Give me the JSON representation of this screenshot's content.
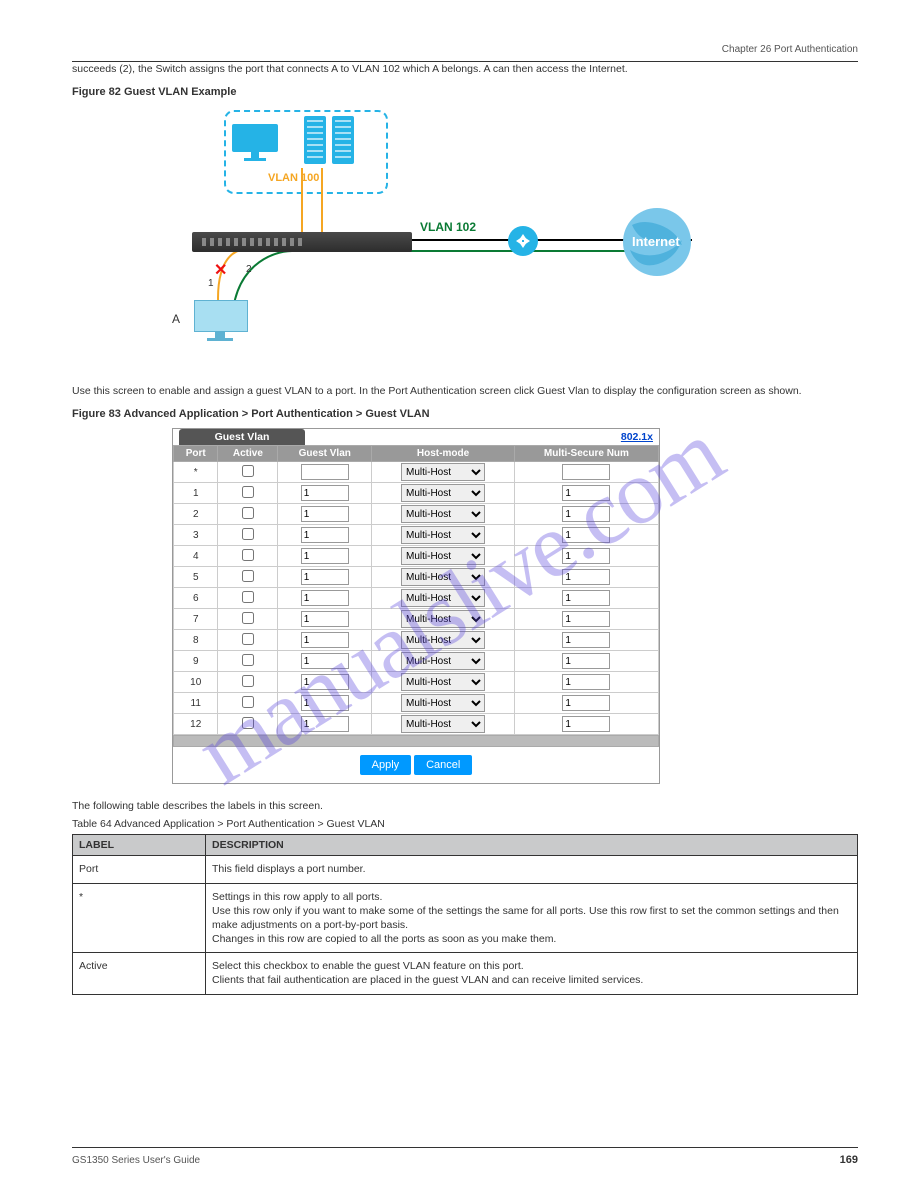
{
  "header": {
    "left": "",
    "right": "Chapter 26 Port Authentication"
  },
  "para_intro": "succeeds (2), the Switch assigns the port that connects A to VLAN 102 which A belongs. A can then access the Internet.",
  "figure82_title": "Figure 82  Guest VLAN Example",
  "diagram": {
    "vlan100": "VLAN 100",
    "vlan102": "VLAN 102",
    "internet": "Internet",
    "markerA": "A",
    "marker1": "1",
    "marker2": "2"
  },
  "body2": "Use this screen to enable and assign a guest VLAN to a port. In the Port Authentication screen click Guest Vlan to display the configuration screen as shown.",
  "figure83_title": "Figure 83  Advanced Application > Port Authentication > Guest VLAN",
  "screenshot": {
    "tab": "Guest Vlan",
    "link": "802.1x",
    "columns": [
      "Port",
      "Active",
      "Guest Vlan",
      "Host-mode",
      "Multi-Secure Num"
    ],
    "star": "*",
    "rows": [
      {
        "port": "1",
        "gvlan": "1",
        "mode": "Multi-Host",
        "msn": "1"
      },
      {
        "port": "2",
        "gvlan": "1",
        "mode": "Multi-Host",
        "msn": "1"
      },
      {
        "port": "3",
        "gvlan": "1",
        "mode": "Multi-Host",
        "msn": "1"
      },
      {
        "port": "4",
        "gvlan": "1",
        "mode": "Multi-Host",
        "msn": "1"
      },
      {
        "port": "5",
        "gvlan": "1",
        "mode": "Multi-Host",
        "msn": "1"
      },
      {
        "port": "6",
        "gvlan": "1",
        "mode": "Multi-Host",
        "msn": "1"
      },
      {
        "port": "7",
        "gvlan": "1",
        "mode": "Multi-Host",
        "msn": "1"
      },
      {
        "port": "8",
        "gvlan": "1",
        "mode": "Multi-Host",
        "msn": "1"
      },
      {
        "port": "9",
        "gvlan": "1",
        "mode": "Multi-Host",
        "msn": "1"
      },
      {
        "port": "10",
        "gvlan": "1",
        "mode": "Multi-Host",
        "msn": "1"
      },
      {
        "port": "11",
        "gvlan": "1",
        "mode": "Multi-Host",
        "msn": "1"
      },
      {
        "port": "12",
        "gvlan": "1",
        "mode": "Multi-Host",
        "msn": "1"
      }
    ],
    "select_default": "Multi-Host",
    "apply": "Apply",
    "cancel": "Cancel"
  },
  "desc_intro": "The following table describes the labels in this screen.",
  "desc_table_title": "Table 64  Advanced Application > Port Authentication > Guest VLAN",
  "desc_table": {
    "h1": "LABEL",
    "h2": "DESCRIPTION",
    "rows": [
      {
        "label": "Port",
        "desc": "This field displays a port number."
      },
      {
        "label": "*",
        "desc": "Settings in this row apply to all ports.\nUse this row only if you want to make some of the settings the same for all ports. Use this row first to set the common settings and then make adjustments on a port-by-port basis.\nChanges in this row are copied to all the ports as soon as you make them."
      },
      {
        "label": "Active",
        "desc": "Select this checkbox to enable the guest VLAN feature on this port.\nClients that fail authentication are placed in the guest VLAN and can receive limited services."
      }
    ]
  },
  "footer": "GS1350 Series User's Guide",
  "page": "169"
}
